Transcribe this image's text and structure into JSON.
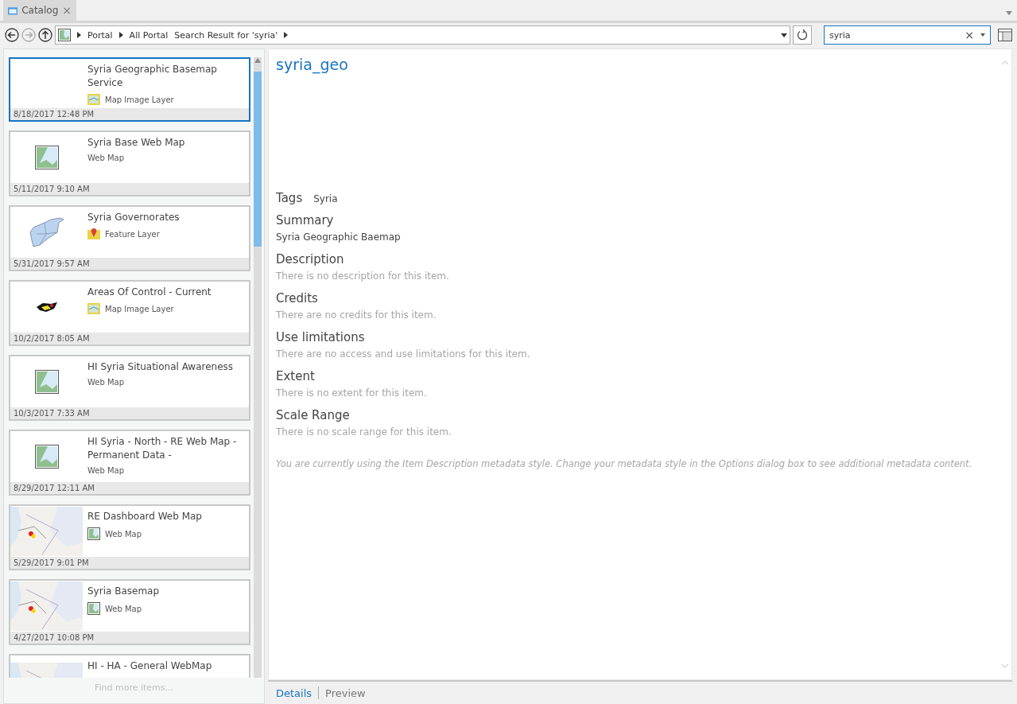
{
  "tab": {
    "title": "Catalog",
    "close": "×"
  },
  "toolbar": {
    "breadcrumbs": [
      "Portal",
      "All Portal",
      "Search Result for 'syria'"
    ],
    "search": {
      "value": "syria",
      "clear": "×"
    }
  },
  "items": [
    {
      "title": "Syria Geographic Basemap Service",
      "type": "Map Image Layer",
      "type_icon": {
        "kind": "map-image"
      },
      "date": "8/18/2017 12:48 PM",
      "selected": true
    },
    {
      "title": "Syria Base Web Map",
      "type": "Web Map",
      "thumbnail": {
        "kind": "webmap"
      },
      "date": "5/11/2017 9:10 AM",
      "selected": false
    },
    {
      "title": "Syria Governorates",
      "type": "Feature Layer",
      "type_icon": {
        "kind": "feature"
      },
      "thumbnail": {
        "kind": "governorates"
      },
      "date": "5/31/2017 9:57 AM",
      "selected": false
    },
    {
      "title": "Areas Of Control - Current",
      "type": "Map Image Layer",
      "type_icon": {
        "kind": "map-image"
      },
      "thumbnail": {
        "kind": "control"
      },
      "date": "10/2/2017 8:05 AM",
      "selected": false
    },
    {
      "title": "HI Syria Situational Awareness",
      "type": "Web Map",
      "thumbnail": {
        "kind": "webmap"
      },
      "date": "10/3/2017 7:33 AM",
      "selected": false
    },
    {
      "title": "HI Syria - North - RE Web Map - Permanent Data -",
      "type": "Web Map",
      "thumbnail": {
        "kind": "webmap"
      },
      "date": "8/29/2017 12:11 AM",
      "selected": false
    },
    {
      "title": "RE Dashboard Web Map",
      "type": "Web Map",
      "type_icon": {
        "kind": "web-map"
      },
      "date": "5/29/2017 9:01 PM",
      "selected": false
    },
    {
      "title": "Syria Basemap",
      "type": "Web Map",
      "type_icon": {
        "kind": "web-map"
      },
      "date": "4/27/2017 10:08 PM",
      "selected": false
    },
    {
      "title": "HI - HA - General WebMap",
      "selected": false
    }
  ],
  "find_more": "Find more items...",
  "details": {
    "title": "syria_geo",
    "tags_label": "Tags",
    "tags": "Syria",
    "sections": [
      {
        "heading": "Summary",
        "text": "Syria Geographic Baemap",
        "empty": false
      },
      {
        "heading": "Description",
        "text": "There is no description for this item.",
        "empty": true
      },
      {
        "heading": "Credits",
        "text": "There are no credits for this item.",
        "empty": true
      },
      {
        "heading": "Use limitations",
        "text": "There are no access and use limitations for this item.",
        "empty": true
      },
      {
        "heading": "Extent",
        "text": "There is no extent for this item.",
        "empty": true
      },
      {
        "heading": "Scale Range",
        "text": "There is no scale range for this item.",
        "empty": true
      }
    ],
    "note": "You are currently using the Item Description metadata style. Change your metadata style in the Options dialog box to see additional metadata content."
  },
  "bottom_tabs": [
    {
      "label": "Details",
      "selected": true
    },
    {
      "label": "Preview",
      "selected": false
    }
  ]
}
